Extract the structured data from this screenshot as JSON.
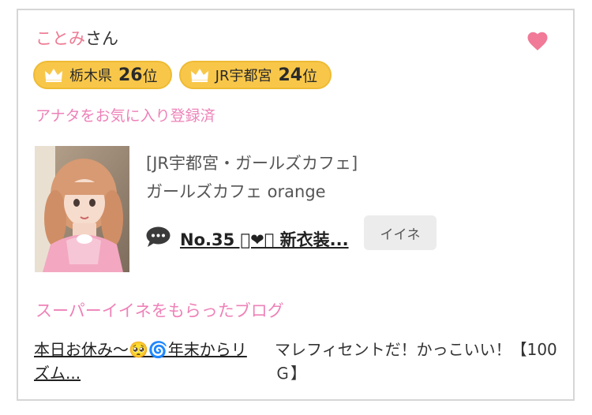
{
  "girl": {
    "name": "ことみ",
    "honorific": "さん"
  },
  "badges": [
    {
      "area": "栃木県",
      "rank": "26",
      "unit": "位"
    },
    {
      "area": "JR宇都宮",
      "rank": "24",
      "unit": "位"
    }
  ],
  "favorite_status": "アナタをお気に入り登録済",
  "shop": {
    "area": "[JR宇都宮・ガールズカフェ]",
    "name": "ガールズカフェ orange"
  },
  "post": {
    "title": "No.35 ︨❤︩ 新衣装..."
  },
  "iine_button": "イイネ",
  "super_iine": {
    "heading": "スーパーイイネをもらったブログ",
    "blog_title": "本日お休み〜🥺🌀年末からリズム...",
    "blog_comment": "マレフィセントだ！かっこいい！【100Ｇ】"
  },
  "colors": {
    "accent_pink": "#ee82b8",
    "name_pink": "#ee7a92",
    "heart": "#f07a97",
    "badge_gold": "#f8c74a"
  },
  "icons": {
    "favorite": "heart-icon",
    "rank": "crown-icon",
    "post": "comment-bubble-icon"
  }
}
